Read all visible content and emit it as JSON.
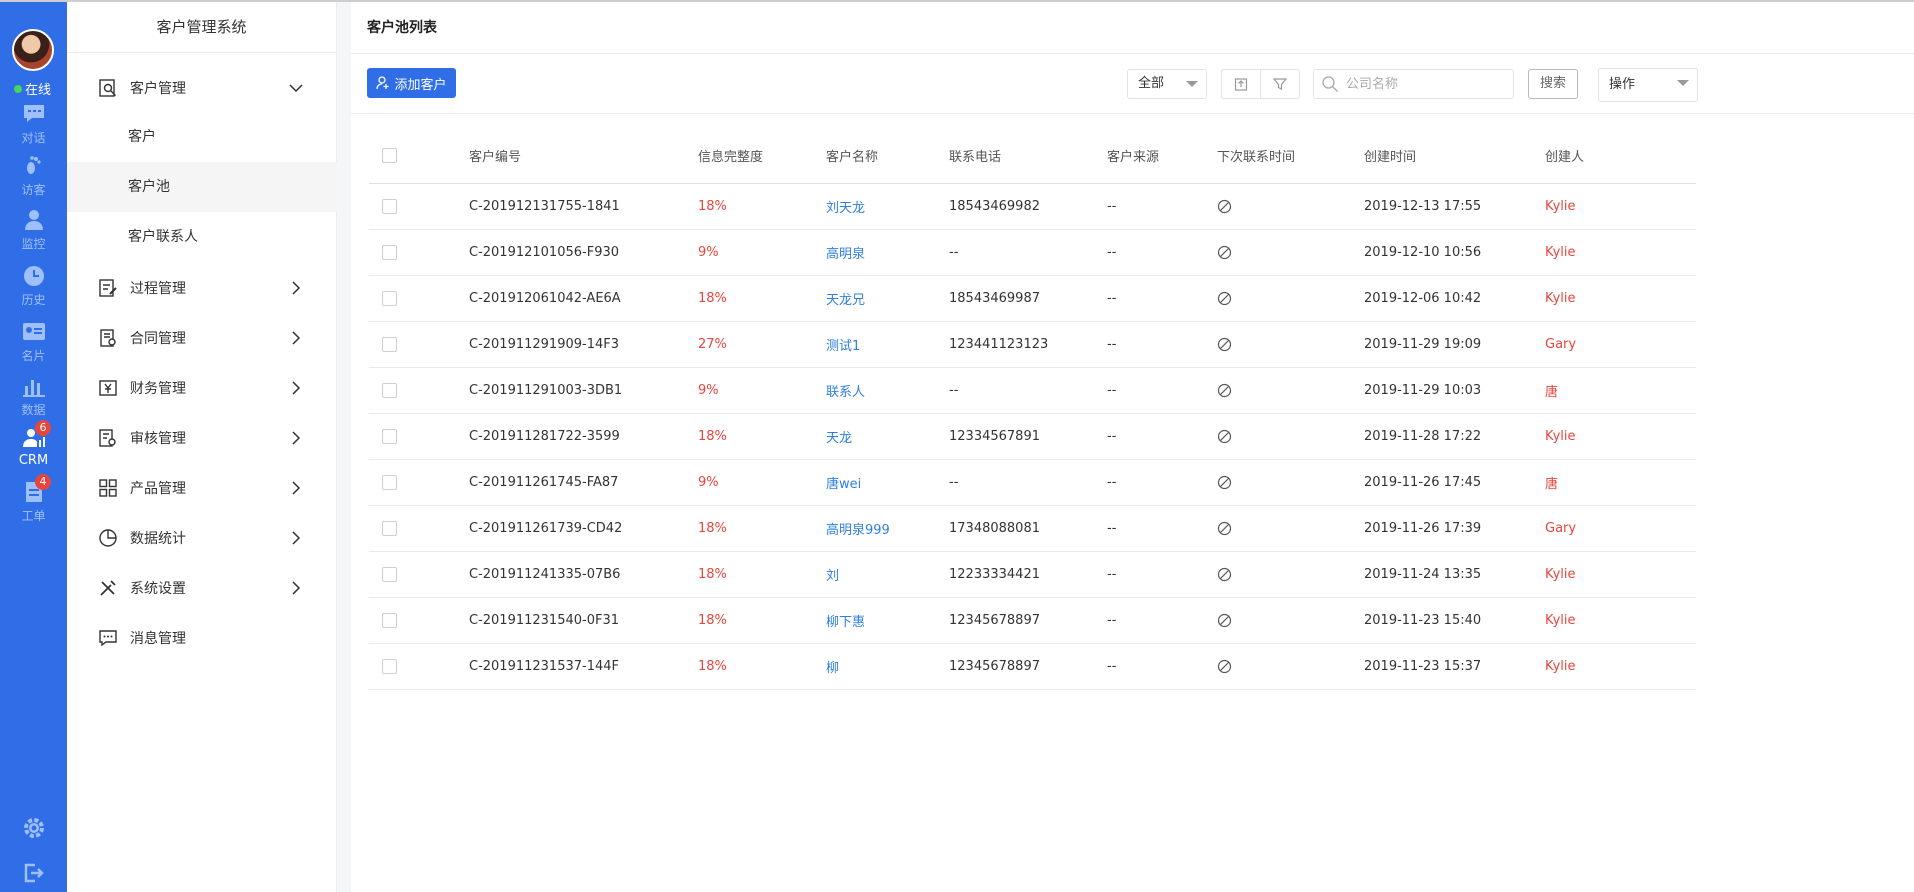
{
  "rail": {
    "status": "在线",
    "items": [
      {
        "label": "对话",
        "icon": "chat-icon"
      },
      {
        "label": "访客",
        "icon": "footprint-icon"
      },
      {
        "label": "监控",
        "icon": "monitor-user-icon"
      },
      {
        "label": "历史",
        "icon": "clock-icon"
      },
      {
        "label": "名片",
        "icon": "id-card-icon"
      },
      {
        "label": "数据",
        "icon": "bar-chart-icon"
      },
      {
        "label": "CRM",
        "icon": "crm-icon",
        "badge": "6"
      },
      {
        "label": "工单",
        "icon": "ticket-icon",
        "badge": "4"
      }
    ]
  },
  "sidebar": {
    "title": "客户管理系统",
    "menu": [
      {
        "label": "客户管理",
        "icon": "customer-search-icon"
      },
      {
        "label": "过程管理",
        "icon": "edit-doc-icon"
      },
      {
        "label": "合同管理",
        "icon": "contract-icon"
      },
      {
        "label": "财务管理",
        "icon": "finance-icon"
      },
      {
        "label": "审核管理",
        "icon": "audit-icon"
      },
      {
        "label": "产品管理",
        "icon": "product-grid-icon"
      },
      {
        "label": "数据统计",
        "icon": "pie-chart-icon"
      },
      {
        "label": "系统设置",
        "icon": "tools-icon"
      },
      {
        "label": "消息管理",
        "icon": "message-icon"
      }
    ],
    "submenu": [
      "客户",
      "客户池",
      "客户联系人"
    ]
  },
  "main": {
    "title": "客户池列表",
    "add_button": "添加客户",
    "filter_select": "全部",
    "search_placeholder": "公司名称",
    "search_button": "搜索",
    "operation_select": "操作"
  },
  "table": {
    "headers": [
      "客户编号",
      "信息完整度",
      "客户名称",
      "联系电话",
      "客户来源",
      "下次联系时间",
      "创建时间",
      "创建人"
    ],
    "rows": [
      {
        "id": "C-201912131755-1841",
        "completeness": "18%",
        "name": "刘天龙",
        "phone": "18543469982",
        "source": "--",
        "created": "2019-12-13 17:55",
        "creator": "Kylie"
      },
      {
        "id": "C-201912101056-F930",
        "completeness": "9%",
        "name": "高明泉",
        "phone": "--",
        "source": "--",
        "created": "2019-12-10 10:56",
        "creator": "Kylie"
      },
      {
        "id": "C-201912061042-AE6A",
        "completeness": "18%",
        "name": "天龙兄",
        "phone": "18543469987",
        "source": "--",
        "created": "2019-12-06 10:42",
        "creator": "Kylie"
      },
      {
        "id": "C-201911291909-14F3",
        "completeness": "27%",
        "name": "测试1",
        "phone": "123441123123",
        "source": "--",
        "created": "2019-11-29 19:09",
        "creator": "Gary"
      },
      {
        "id": "C-201911291003-3DB1",
        "completeness": "9%",
        "name": "联系人",
        "phone": "--",
        "source": "--",
        "created": "2019-11-29 10:03",
        "creator": "唐"
      },
      {
        "id": "C-201911281722-3599",
        "completeness": "18%",
        "name": "天龙",
        "phone": "12334567891",
        "source": "--",
        "created": "2019-11-28 17:22",
        "creator": "Kylie"
      },
      {
        "id": "C-201911261745-FA87",
        "completeness": "9%",
        "name": "唐wei",
        "phone": "--",
        "source": "--",
        "created": "2019-11-26 17:45",
        "creator": "唐"
      },
      {
        "id": "C-201911261739-CD42",
        "completeness": "18%",
        "name": "高明泉999",
        "phone": "17348088081",
        "source": "--",
        "created": "2019-11-26 17:39",
        "creator": "Gary"
      },
      {
        "id": "C-201911241335-07B6",
        "completeness": "18%",
        "name": "刘",
        "phone": "12233334421",
        "source": "--",
        "created": "2019-11-24 13:35",
        "creator": "Kylie"
      },
      {
        "id": "C-201911231540-0F31",
        "completeness": "18%",
        "name": "柳下惠",
        "phone": "12345678897",
        "source": "--",
        "created": "2019-11-23 15:40",
        "creator": "Kylie"
      },
      {
        "id": "C-201911231537-144F",
        "completeness": "18%",
        "name": "柳",
        "phone": "12345678897",
        "source": "--",
        "created": "2019-11-23 15:37",
        "creator": "Kylie"
      }
    ]
  },
  "colors": {
    "primary": "#2f6ee6",
    "danger": "#e8453c",
    "link": "#2f7fe0",
    "online": "#45d55a"
  }
}
